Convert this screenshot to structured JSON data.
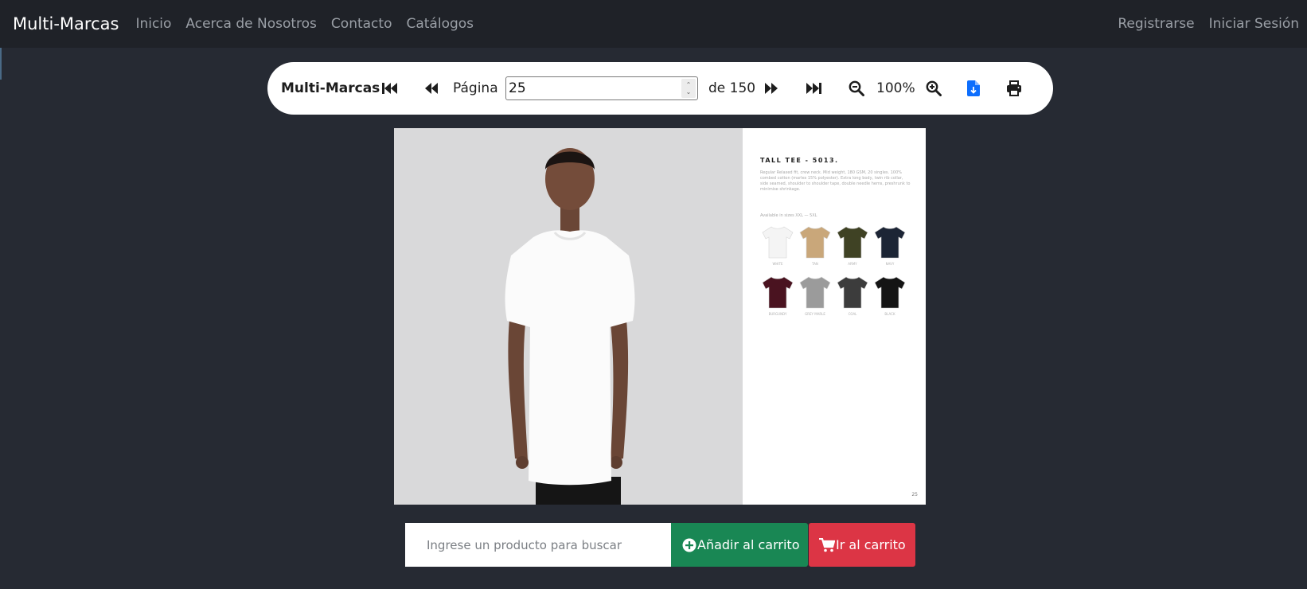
{
  "navbar": {
    "brand": "Multi-Marcas",
    "links": [
      "Inicio",
      "Acerca de Nosotros",
      "Contacto",
      "Catálogos"
    ],
    "register": "Registrarse",
    "login": "Iniciar Sesión"
  },
  "toolbar": {
    "title": "Multi-Marcas",
    "page_label": "Página",
    "page_value": "25",
    "page_total": "de 150",
    "zoom": "100%",
    "icons": [
      "first-page-icon",
      "previous-page-icon",
      "next-page-icon",
      "last-page-icon",
      "zoom-out-icon",
      "zoom-in-icon",
      "download-icon",
      "print-icon"
    ]
  },
  "catalog": {
    "product_title": "TALL TEE - 5013.",
    "description": "Regular Relaxed fit, crew neck. Mid weight, 180 GSM, 20 singles. 100% combed cotton (marles 15% polyester). Extra long body, twin rib collar, side seamed, shoulder to shoulder tape, double needle hems, preshrunk to minimise shrinkage.",
    "sizes": "Available in sizes XXL — 5XL",
    "swatches": [
      {
        "name": "White",
        "color": "#f4f4f4"
      },
      {
        "name": "Tan",
        "color": "#c9a77a"
      },
      {
        "name": "Army",
        "color": "#3f4224"
      },
      {
        "name": "Navy",
        "color": "#1c2535"
      },
      {
        "name": "Burgundy",
        "color": "#4a1320"
      },
      {
        "name": "Grey Marle",
        "color": "#9b9b9b"
      },
      {
        "name": "Coal",
        "color": "#3c3c3c"
      },
      {
        "name": "Black",
        "color": "#141414"
      }
    ],
    "page_number": "25"
  },
  "actions": {
    "search_placeholder": "Ingrese un producto para buscar",
    "add_to_cart": "Añadir al carrito",
    "go_to_cart": "Ir al carrito"
  },
  "colors": {
    "nav_bg": "#1f2228",
    "page_bg": "#262a33",
    "success": "#198754",
    "danger": "#dc3545",
    "download_icon": "#0d6efd"
  }
}
